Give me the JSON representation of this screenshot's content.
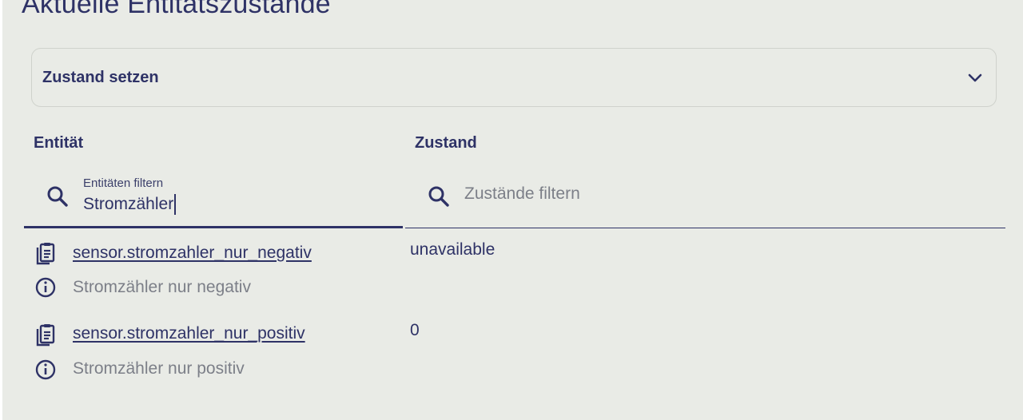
{
  "page": {
    "title": "Aktuelle Entitätszustände"
  },
  "expander": {
    "label": "Zustand setzen",
    "icon": "chevron-down-icon"
  },
  "table": {
    "columns": [
      "Entität",
      "Zustand"
    ],
    "entity_filter": {
      "label": "Entitäten filtern",
      "value": "Stromzähler",
      "icon": "search-icon"
    },
    "state_filter": {
      "placeholder": "Zustände filtern",
      "value": "",
      "icon": "search-icon"
    },
    "rows": [
      {
        "entity_id": "sensor.stromzahler_nur_negativ",
        "friendly_name": "Stromzähler nur negativ",
        "state": "unavailable",
        "copy_icon": "clipboard-icon",
        "info_icon": "info-icon"
      },
      {
        "entity_id": "sensor.stromzahler_nur_positiv",
        "friendly_name": "Stromzähler nur positiv",
        "state": "0",
        "copy_icon": "clipboard-icon",
        "info_icon": "info-icon"
      }
    ]
  },
  "colors": {
    "background": "#e9ebe6",
    "primary_text": "#2e3266",
    "secondary_text": "#7c7f88",
    "border": "#cfd2cc"
  }
}
